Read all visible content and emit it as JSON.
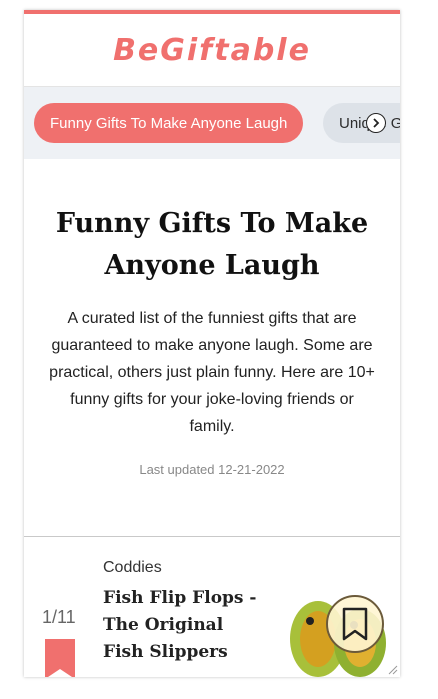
{
  "brand": {
    "logo_text": "BeGiftable",
    "accent": "#f0706e"
  },
  "tabs": [
    {
      "label": "Funny Gifts To Make Anyone Laugh",
      "active": true
    },
    {
      "label": "Unique G",
      "active": false
    }
  ],
  "tabs_next_icon": "chevron-right-icon",
  "article": {
    "title": "Funny Gifts To Make Anyone Laugh",
    "description": "A curated list of the funniest gifts that are guaranteed to make anyone laugh. Some are practical, others just plain funny. Here are 10+ funny gifts for your joke-loving friends or family.",
    "updated": "Last updated 12-21-2022"
  },
  "item": {
    "counter": "1/11",
    "brand": "Coddies",
    "title": "Fish Flip Flops - The Original Fish Slippers"
  },
  "fab_icon": "bookmark-icon"
}
